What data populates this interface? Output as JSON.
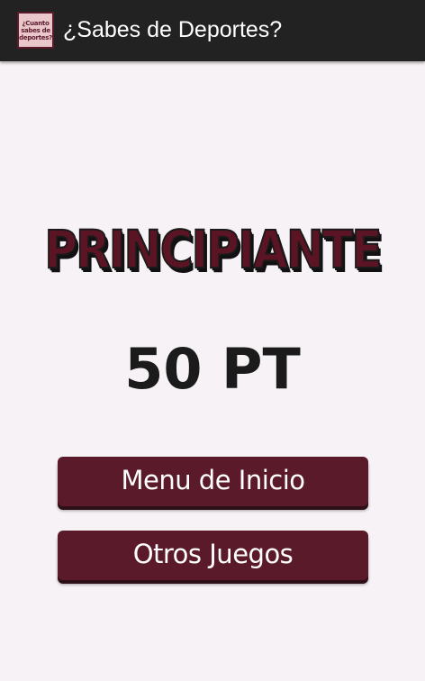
{
  "action_bar": {
    "title": "¿Sabes de Deportes?",
    "app_icon_text": [
      "¿Cuanto",
      "sabes de",
      "deportes?"
    ]
  },
  "result": {
    "level": "PRINCIPIANTE",
    "score": "50 PT"
  },
  "buttons": {
    "main_menu": "Menu de Inicio",
    "other_games": "Otros Juegos"
  }
}
